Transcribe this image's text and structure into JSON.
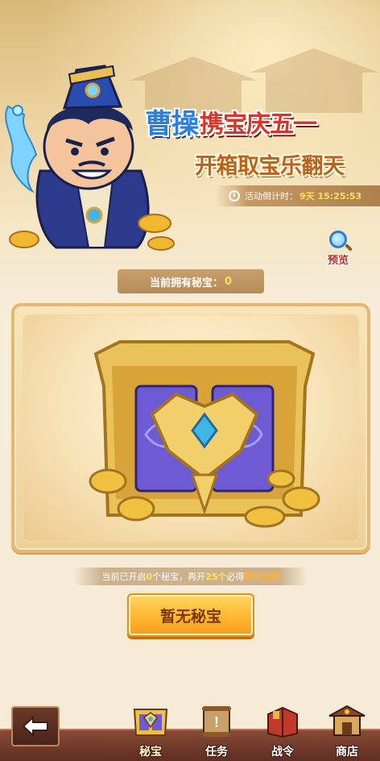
{
  "banner": {
    "title_name": "曹操",
    "title_rest": "携宝庆五一",
    "subtitle": "开箱取宝乐翻天",
    "countdown_label": "活动倒计时：",
    "countdown_value": "9天 15:25:53",
    "preview_label": "预览"
  },
  "treasure": {
    "owned_label": "当前拥有秘宝：",
    "owned_count": "0"
  },
  "hint": {
    "part1": "当前已开启",
    "opened": "0",
    "part2": "个秘宝，再开",
    "remaining": "25个",
    "part3": "必得",
    "reward": "稀有奖励"
  },
  "action": {
    "button_label": "暂无秘宝"
  },
  "nav": {
    "tabs": [
      {
        "label": "秘宝",
        "icon": "chest-icon",
        "active": true
      },
      {
        "label": "任务",
        "icon": "scroll-icon",
        "active": false
      },
      {
        "label": "战令",
        "icon": "book-icon",
        "active": false
      },
      {
        "label": "商店",
        "icon": "shop-icon",
        "active": false
      }
    ]
  },
  "colors": {
    "title_blue": "#2b7fdc",
    "title_red": "#d9362a",
    "accent_yellow": "#ffe15a",
    "button_orange": "#ffb42e"
  }
}
